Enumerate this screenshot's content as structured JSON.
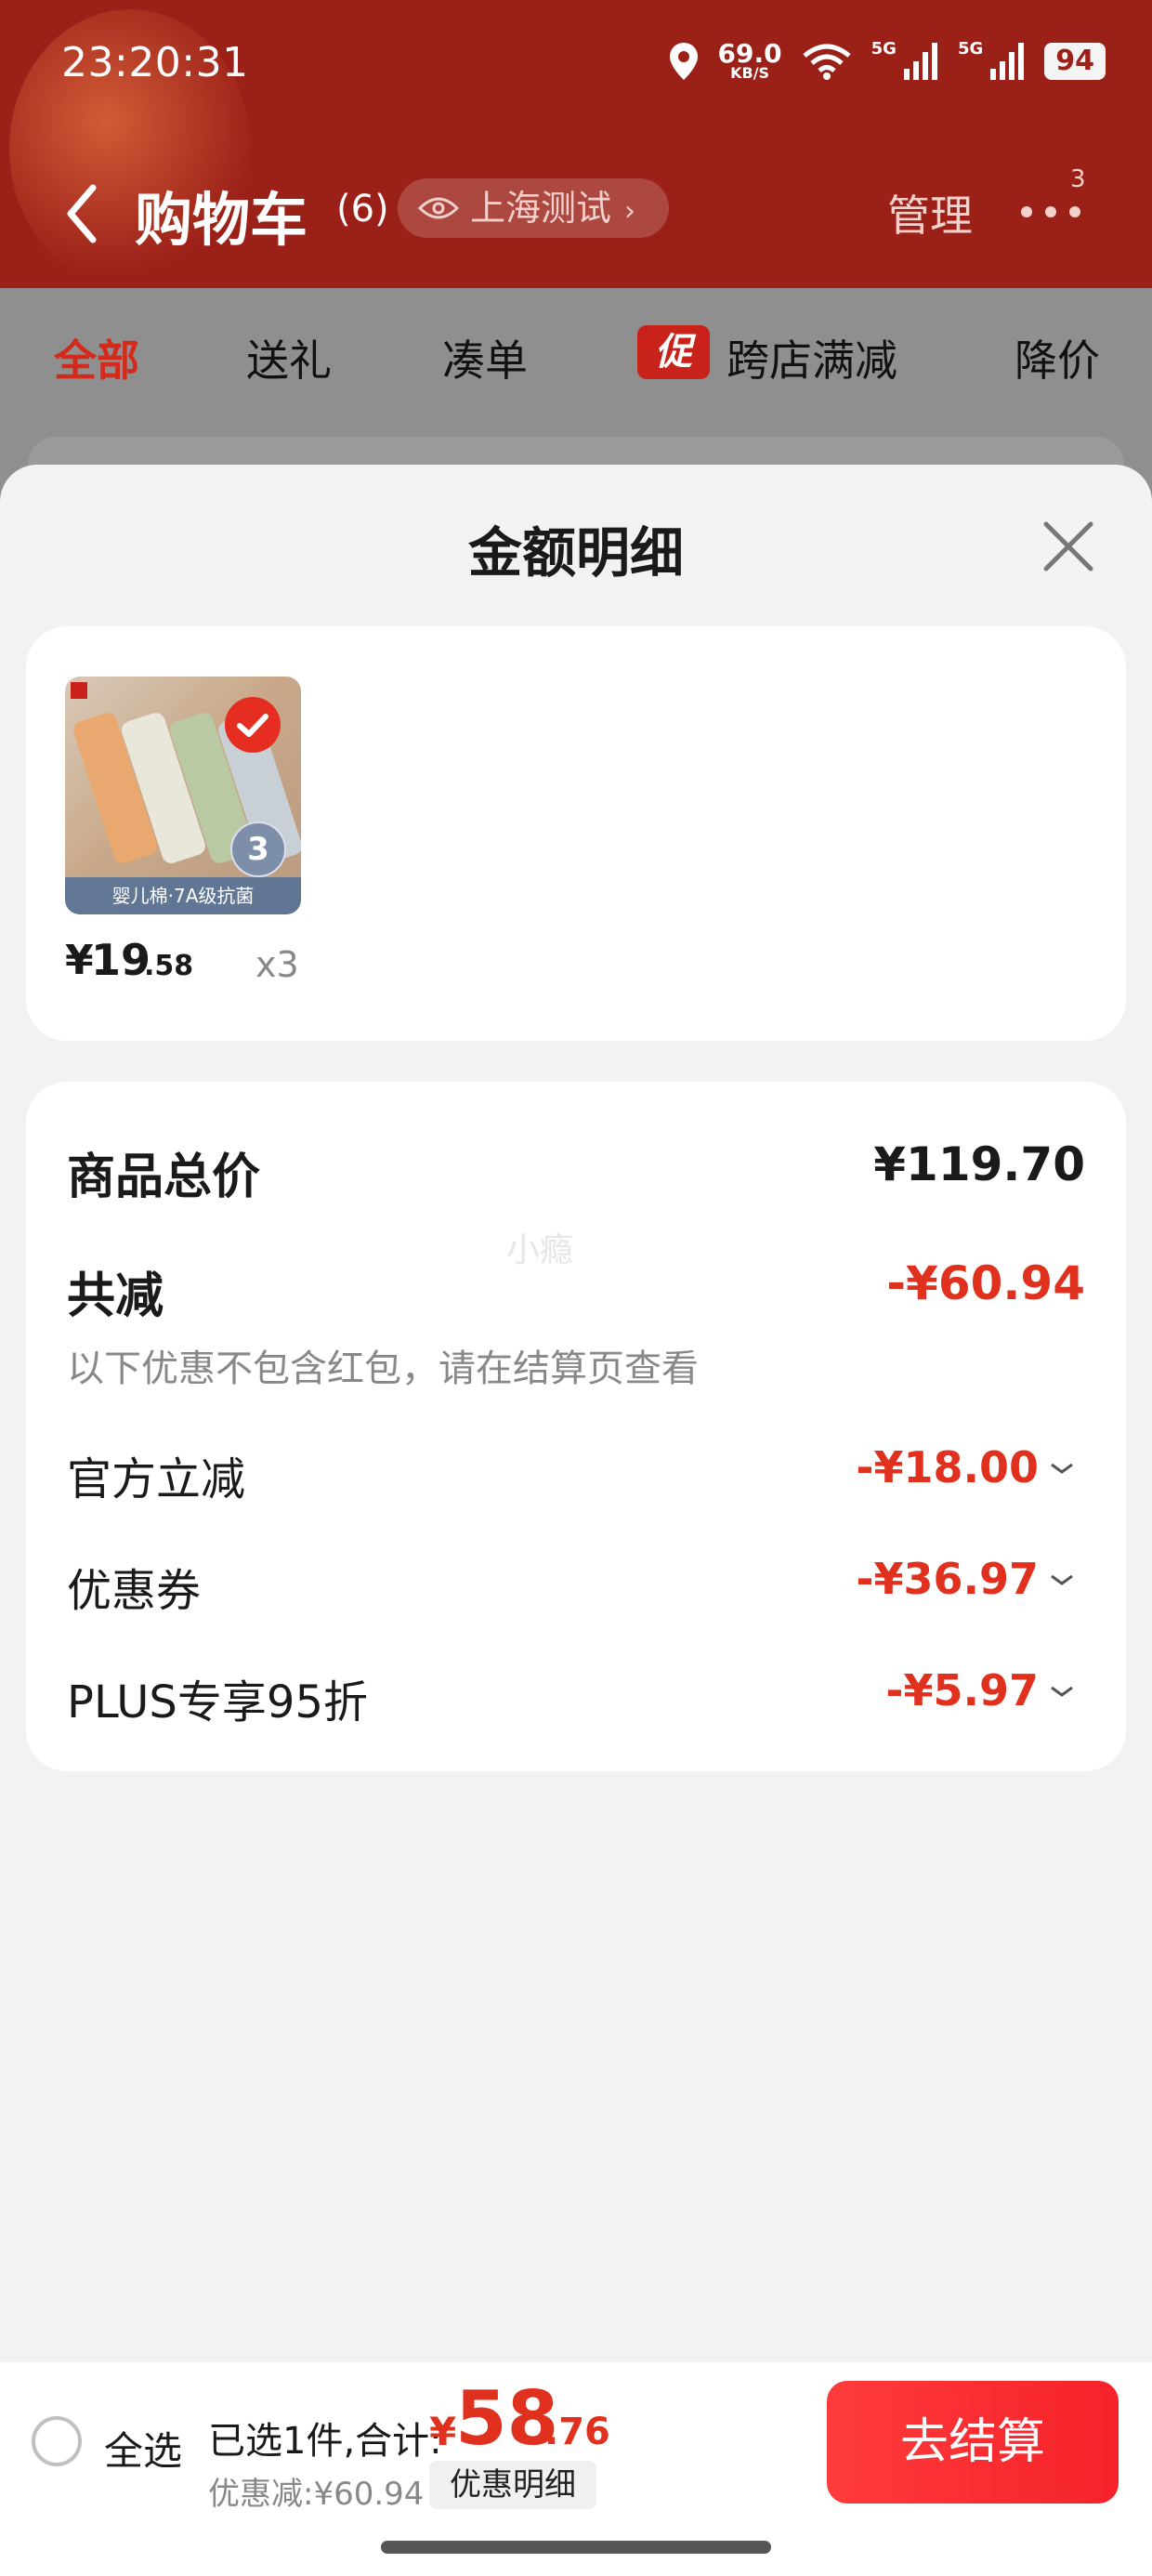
{
  "status_bar": {
    "time": "23:20:31",
    "speed_value": "69.0",
    "speed_unit": "KB/S",
    "net1": "5G",
    "net2": "5G",
    "battery": "94"
  },
  "header": {
    "title": "购物车",
    "count": "(6)",
    "location": "上海测试",
    "manage": "管理",
    "more_badge": "3"
  },
  "tabs": [
    {
      "label": "全部",
      "active": true
    },
    {
      "label": "送礼"
    },
    {
      "label": "凑单"
    },
    {
      "label": "跨店满减",
      "tag": "促"
    },
    {
      "label": "降价"
    }
  ],
  "sheet": {
    "title": "金额明细",
    "product": {
      "image_caption": "婴儿棉·7A级抗菌",
      "image_badge": "3",
      "price_symbol": "¥",
      "price_int": "19",
      "price_dec": ".58",
      "qty": "x3"
    },
    "total": {
      "label": "商品总价",
      "value": "¥119.70"
    },
    "reduction": {
      "label": "共减",
      "value": "-¥60.94",
      "note": "以下优惠不包含红包，请在结算页查看"
    },
    "discounts": [
      {
        "label": "官方立减",
        "value": "-¥18.00"
      },
      {
        "label": "优惠券",
        "value": "-¥36.97"
      },
      {
        "label": "PLUS专享95折",
        "value": "-¥5.97"
      }
    ],
    "watermark": "小瘾"
  },
  "bottom_bar": {
    "select_all": "全选",
    "selected_text": "已选1件,合计:",
    "total_symbol": "¥",
    "total_int": "58",
    "total_dec": ".76",
    "discount_text": "优惠减:¥60.94",
    "detail_button": "优惠明细",
    "checkout": "去结算"
  },
  "colors": {
    "accent_red": "#e0301e",
    "header_bg": "#9b2018"
  }
}
